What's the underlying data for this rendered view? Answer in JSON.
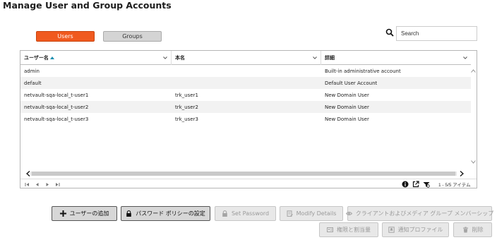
{
  "header": {
    "title": "Manage User and Group Accounts"
  },
  "toggles": {
    "users": "Users",
    "groups": "Groups"
  },
  "search": {
    "placeholder": "Search"
  },
  "grid": {
    "columns": [
      "ユーザー名",
      "本名",
      "詳細"
    ],
    "rows": [
      [
        "admin",
        "",
        "Built-in administrative account"
      ],
      [
        "default",
        "",
        "Default User Account"
      ],
      [
        "netvault-sqa-local_t-user1",
        "trk_user1",
        "New Domain User"
      ],
      [
        "netvault-sqa-local_t-user2",
        "trk_user2",
        "New Domain User"
      ],
      [
        "netvault-sqa-local_t-user3",
        "trk_user3",
        "New Domain User"
      ]
    ],
    "page_info": "1 - 5/5 アイテム"
  },
  "buttons": {
    "add_user": "ユーザーの追加",
    "password_policy": "パスワード ポリシーの設定",
    "set_password": "Set Password",
    "modify_details": "Modify Details",
    "client_media": "クライアントおよびメディア グループ メンバーシップ",
    "privileges_quotas": "権限と割当量",
    "notification_profile": "通知プロファイル",
    "delete": "削除"
  },
  "colors": {
    "accent": "#f05a1f",
    "sort_arrow": "#1b8fb0"
  }
}
